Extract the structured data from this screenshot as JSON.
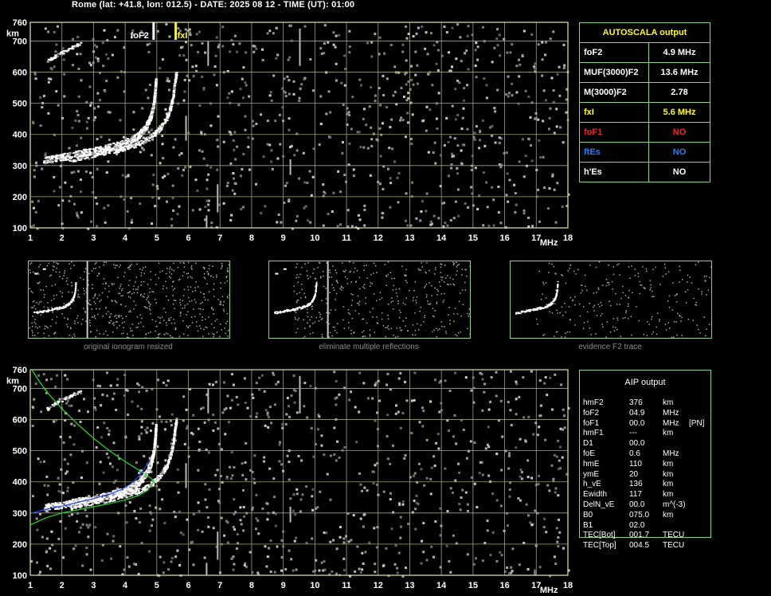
{
  "header": {
    "text": "Rome (lat: +41.8, lon: 012.5) - DATE: 2025 08 12 - TIME (UT): 01:00"
  },
  "chart_data": [
    {
      "type": "scatter",
      "name": "top_ionogram",
      "xlabel": "MHz",
      "ylabel": "km",
      "x_ticks": [
        "1",
        "2",
        "3",
        "4",
        "5",
        "6",
        "7",
        "8",
        "9",
        "10",
        "11",
        "12",
        "13",
        "14",
        "15",
        "16",
        "17",
        "18"
      ],
      "y_ticks": [
        "760",
        "700",
        "600",
        "500",
        "400",
        "300",
        "200",
        "100"
      ],
      "xlim": [
        1,
        18
      ],
      "ylim": [
        100,
        760
      ],
      "grid": true,
      "markers": [
        {
          "label": "foF2",
          "x": 4.9,
          "color": "#ffffff"
        },
        {
          "label": "fxI",
          "x": 5.6,
          "color": "#ffff00"
        }
      ],
      "trace_o": [
        [
          1.4,
          318
        ],
        [
          1.8,
          325
        ],
        [
          2.2,
          333
        ],
        [
          2.6,
          342
        ],
        [
          3.0,
          350
        ],
        [
          3.4,
          358
        ],
        [
          3.8,
          368
        ],
        [
          4.1,
          380
        ],
        [
          4.35,
          395
        ],
        [
          4.55,
          415
        ],
        [
          4.7,
          440
        ],
        [
          4.8,
          465
        ],
        [
          4.88,
          500
        ],
        [
          4.92,
          540
        ],
        [
          4.95,
          580
        ]
      ],
      "trace_x": [
        [
          2.2,
          320
        ],
        [
          2.6,
          330
        ],
        [
          3.0,
          338
        ],
        [
          3.4,
          346
        ],
        [
          3.8,
          355
        ],
        [
          4.2,
          366
        ],
        [
          4.6,
          382
        ],
        [
          4.9,
          402
        ],
        [
          5.1,
          425
        ],
        [
          5.3,
          455
        ],
        [
          5.42,
          490
        ],
        [
          5.5,
          530
        ],
        [
          5.55,
          575
        ],
        [
          5.6,
          600
        ]
      ]
    },
    {
      "type": "line",
      "name": "bottom_ionogram",
      "xlabel": "MHz",
      "ylabel": "km",
      "x_ticks": [
        "1",
        "2",
        "3",
        "4",
        "5",
        "6",
        "7",
        "8",
        "9",
        "10",
        "11",
        "12",
        "13",
        "14",
        "15",
        "16",
        "17",
        "18"
      ],
      "y_ticks": [
        "760",
        "700",
        "600",
        "500",
        "400",
        "300",
        "200",
        "100"
      ],
      "xlim": [
        1,
        18
      ],
      "ylim": [
        100,
        760
      ],
      "grid": true,
      "profile_green_upper": [
        [
          1.05,
          760
        ],
        [
          1.3,
          720
        ],
        [
          1.6,
          680
        ],
        [
          2.0,
          635
        ],
        [
          2.5,
          585
        ],
        [
          3.0,
          540
        ],
        [
          3.5,
          500
        ],
        [
          4.0,
          465
        ],
        [
          4.4,
          440
        ],
        [
          4.7,
          420
        ],
        [
          4.9,
          405
        ]
      ],
      "profile_green_lower": [
        [
          1.0,
          262
        ],
        [
          1.5,
          285
        ],
        [
          2.0,
          300
        ],
        [
          2.5,
          310
        ],
        [
          3.0,
          320
        ],
        [
          3.5,
          330
        ],
        [
          4.0,
          342
        ],
        [
          4.4,
          355
        ],
        [
          4.7,
          372
        ],
        [
          4.85,
          390
        ],
        [
          4.9,
          405
        ]
      ],
      "profile_blue": [
        [
          1.05,
          300
        ],
        [
          1.5,
          312
        ],
        [
          2.0,
          322
        ],
        [
          2.5,
          334
        ],
        [
          3.0,
          346
        ],
        [
          3.5,
          360
        ],
        [
          3.9,
          376
        ],
        [
          4.2,
          395
        ],
        [
          4.5,
          425
        ],
        [
          4.75,
          465
        ]
      ]
    }
  ],
  "autoscala": {
    "title": "AUTOSCALA output",
    "rows": [
      {
        "label": "foF2",
        "value": "4.9 MHz",
        "label_color": "#ffffff",
        "value_color": "#ffffff"
      },
      {
        "label": "MUF(3000)F2",
        "value": "13.6 MHz",
        "label_color": "#ffffff",
        "value_color": "#ffffff"
      },
      {
        "label": "M(3000)F2",
        "value": "2.78",
        "label_color": "#ffffff",
        "value_color": "#ffffff"
      },
      {
        "label": "fxI",
        "value": "5.6 MHz",
        "label_color": "#ffff00",
        "value_color": "#ffff00"
      },
      {
        "label": "foF1",
        "value": "NO",
        "label_color": "#ff2020",
        "value_color": "#ff2020"
      },
      {
        "label": "ftEs",
        "value": "NO",
        "label_color": "#2080ff",
        "value_color": "#2080ff"
      },
      {
        "label": "h'Es",
        "value": "NO",
        "label_color": "#ffffff",
        "value_color": "#ffffff"
      }
    ]
  },
  "thumbnails": [
    {
      "caption": "original ionogram resized"
    },
    {
      "caption": "eliminate multiple reflections"
    },
    {
      "caption": "evidence F2 trace"
    }
  ],
  "aip": {
    "title": "AIP output",
    "rows": [
      {
        "label": "hmF2",
        "value": "376",
        "unit": "km",
        "extra": ""
      },
      {
        "label": "foF2",
        "value": "04.9",
        "unit": "MHz",
        "extra": ""
      },
      {
        "label": "foF1",
        "value": "00.0",
        "unit": "MHz",
        "extra": "[PN]"
      },
      {
        "label": "hmF1",
        "value": "---",
        "unit": "km",
        "extra": ""
      },
      {
        "label": "D1",
        "value": "00.0",
        "unit": "",
        "extra": ""
      },
      {
        "label": "foE",
        "value": "0.6",
        "unit": "MHz",
        "extra": ""
      },
      {
        "label": "hmE",
        "value": "110",
        "unit": "km",
        "extra": ""
      },
      {
        "label": "ymE",
        "value": "20",
        "unit": "km",
        "extra": ""
      },
      {
        "label": "h_vE",
        "value": "136",
        "unit": "km",
        "extra": ""
      },
      {
        "label": "Ewidth",
        "value": "117",
        "unit": "km",
        "extra": ""
      },
      {
        "label": "DelN_vE",
        "value": "00.0",
        "unit": "m^(-3)",
        "extra": ""
      },
      {
        "label": "B0",
        "value": "075.0",
        "unit": "km",
        "extra": ""
      },
      {
        "label": "B1",
        "value": "02.0",
        "unit": "",
        "extra": ""
      },
      {
        "label": "TEC[Bot]",
        "value": "001.7",
        "unit": "TECU",
        "extra": ""
      },
      {
        "label": "TEC[Top]",
        "value": "004.5",
        "unit": "TECU",
        "extra": ""
      }
    ]
  },
  "colors": {
    "grid": "#a3a37a",
    "frame": "#e6e6a0",
    "panel_border": "#8fd18f",
    "green": "#22dd22",
    "blue": "#2244ff",
    "yellow": "#ffff00"
  }
}
